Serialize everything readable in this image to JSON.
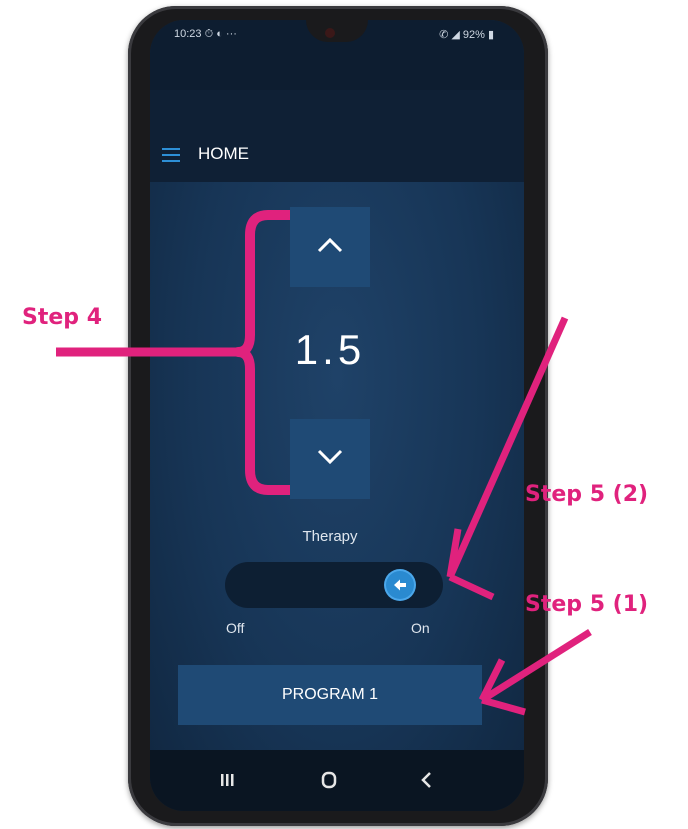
{
  "status_bar": {
    "time": "10:23",
    "left_icons": "⏱ ◐ ···",
    "right_icons": "✆ ◢ 92% ▮"
  },
  "app_bar": {
    "title": "HOME"
  },
  "intensity": {
    "value": "1.5"
  },
  "therapy": {
    "label": "Therapy",
    "off_label": "Off",
    "on_label": "On",
    "state": "on"
  },
  "program_button": {
    "label": "PROGRAM 1"
  },
  "nav_bar": {
    "recents": "III",
    "home": "O",
    "back": "<"
  },
  "annotations": {
    "step4": "Step 4",
    "step5_2": "Step 5 (2)",
    "step5_1": "Step 5 (1)"
  },
  "colors": {
    "annotation": "#e0227d",
    "accent": "#2a8ad0",
    "panel": "#1f4a75"
  },
  "icons": {
    "menu": "hamburger-menu-icon",
    "up": "chevron-up-icon",
    "down": "chevron-down-icon",
    "toggle": "arrow-left-icon"
  }
}
